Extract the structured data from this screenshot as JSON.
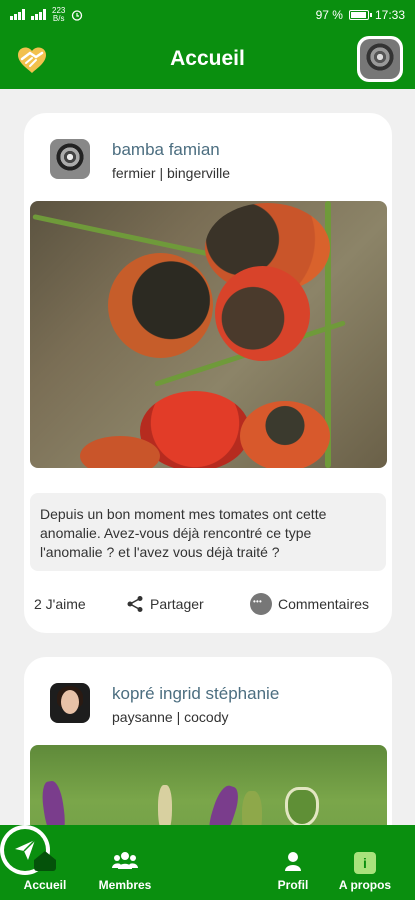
{
  "status_bar": {
    "net_speed_value": "223",
    "net_speed_unit": "B/s",
    "battery": "97 %",
    "time": "17:33"
  },
  "header": {
    "title": "Accueil"
  },
  "posts": [
    {
      "author": "bamba famian",
      "meta": "fermier | bingerville",
      "text": "Depuis un bon moment mes tomates ont cette anomalie. Avez-vous déjà rencontré ce type l'anomalie ? et l'avez vous déjà traité ?",
      "likes": "2 J'aime",
      "share_label": "Partager",
      "comments_label": "Commentaires"
    },
    {
      "author": "kopré ingrid stéphanie",
      "meta": "paysanne | cocody"
    }
  ],
  "nav": {
    "items": [
      {
        "label": "Accueil",
        "icon": "home-icon"
      },
      {
        "label": "Membres",
        "icon": "members-icon"
      },
      {
        "label": "",
        "icon": "send-icon"
      },
      {
        "label": "Profil",
        "icon": "profile-icon"
      },
      {
        "label": "A propos",
        "icon": "info-icon"
      }
    ]
  },
  "colors": {
    "primary": "#0a8f0f",
    "active_nav_icon": "#04520a",
    "author_name": "#4c6e80"
  }
}
